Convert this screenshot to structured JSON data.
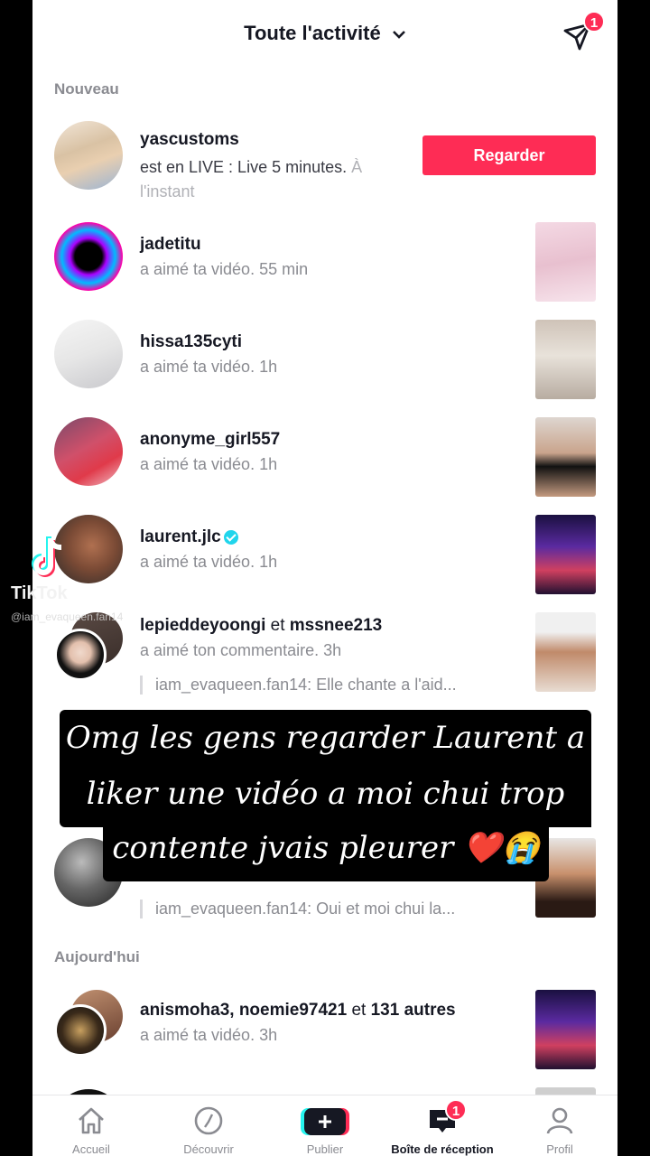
{
  "header": {
    "title": "Toute l'activité",
    "dm_badge": "1"
  },
  "sections": {
    "new": "Nouveau",
    "today": "Aujourd'hui"
  },
  "notifications": [
    {
      "user": "yascustoms",
      "line1": "est en LIVE : Live 5 minutes.",
      "time1": "À",
      "line2": "l'instant",
      "button": "Regarder"
    },
    {
      "user": "jadetitu",
      "action": "a aimé ta vidéo.",
      "time": "55 min"
    },
    {
      "user": "hissa135cyti",
      "action": "a aimé ta vidéo.",
      "time": "1h"
    },
    {
      "user": "anonyme_girl557",
      "action": "a aimé ta vidéo.",
      "time": "1h"
    },
    {
      "user": "laurent.jlc",
      "action": "a aimé ta vidéo.",
      "time": "1h"
    },
    {
      "user": "lepieddeyoongi",
      "joiner": "et",
      "user2": "mssnee213",
      "action": "a aimé ton commentaire.",
      "time": "3h",
      "quote": "iam_evaqueen.fan14: Elle chante a l'aid..."
    },
    {
      "quote": "iam_evaqueen.fan14: Oui et moi chui la..."
    },
    {
      "user": "anismoha3, noemie97421",
      "joiner": "et",
      "others": "131 autres",
      "action": "a aimé ta vidéo.",
      "time": "3h"
    }
  ],
  "overlay": {
    "line1": "Omg les gens regarder Laurent a",
    "line2": "liker une vidéo a moi chui trop",
    "line3": "contente jvais pleurer ❤️😭"
  },
  "watermark": {
    "word": "TikTok",
    "handle": "@iam_evaqueen.fan14"
  },
  "bottom_nav": [
    {
      "label": "Accueil"
    },
    {
      "label": "Découvrir"
    },
    {
      "label": "Publier"
    },
    {
      "label": "Boîte de réception",
      "badge": "1"
    },
    {
      "label": "Profil"
    }
  ],
  "colors": {
    "accent": "#fe2c55",
    "secondary_text": "#8a8b91",
    "verified": "#20d5ec"
  }
}
